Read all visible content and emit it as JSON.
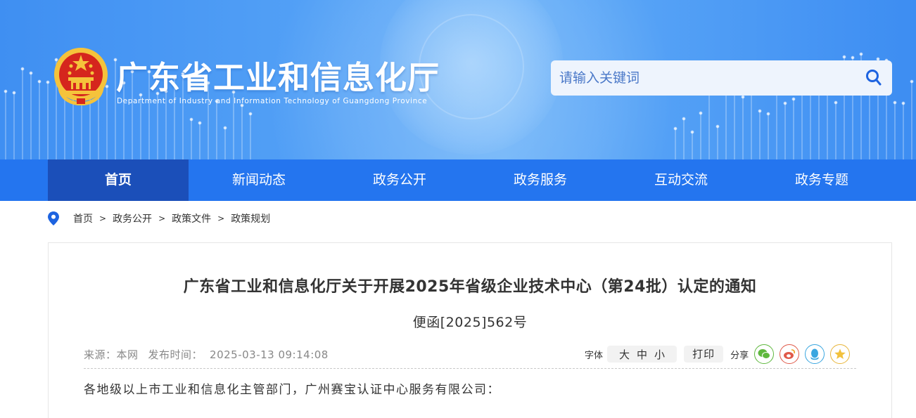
{
  "header": {
    "site_title": "广东省工业和信息化厅",
    "site_subtitle": "Department of Industry and Information Technology of Guangdong Province",
    "emblem_icon": "national-emblem-icon",
    "search_placeholder": "请输入关键词",
    "search_icon": "search-icon",
    "accent_color": "#2475ef"
  },
  "nav": {
    "items": [
      {
        "label": "首页",
        "active": true
      },
      {
        "label": "新闻动态",
        "active": false
      },
      {
        "label": "政务公开",
        "active": false
      },
      {
        "label": "政务服务",
        "active": false
      },
      {
        "label": "互动交流",
        "active": false
      },
      {
        "label": "政务专题",
        "active": false
      }
    ]
  },
  "breadcrumb": {
    "icon": "location-pin-icon",
    "items": [
      "首页",
      "政务公开",
      "政策文件",
      "政策规划"
    ],
    "separator": ">"
  },
  "article": {
    "title": "广东省工业和信息化厅关于开展2025年省级企业技术中心（第24批）认定的通知",
    "doc_number": "便函[2025]562号",
    "source_label": "来源：本网",
    "published_label": "发布时间：",
    "published_time": "2025-03-13 09:14:08",
    "font_label": "字体",
    "font_sizes": [
      "大",
      "中",
      "小"
    ],
    "print_label": "打印",
    "share_label": "分享",
    "share_icons": [
      "wechat-icon",
      "weibo-icon",
      "qq-icon",
      "favorite-star-icon"
    ],
    "salutation": "各地级以上市工业和信息化主管部门，广州赛宝认证中心服务有限公司："
  }
}
